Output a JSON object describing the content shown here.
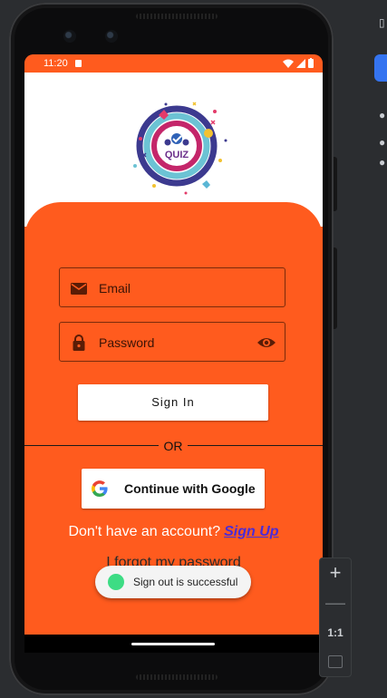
{
  "status_bar": {
    "time": "11:20"
  },
  "logo": {
    "text": "QUIZ",
    "icon": "quiz-logo"
  },
  "login": {
    "email_placeholder": "Email",
    "password_placeholder": "Password",
    "signin_label": "Sign In",
    "divider_text": "OR",
    "google_label": "Continue with Google",
    "signup_prompt": "Don't have an account?",
    "signup_link": "Sign Up",
    "forgot_label": "I forgot my password"
  },
  "toast": {
    "message": "Sign out is successful"
  },
  "emulator_zoom": {
    "plus": "+",
    "minus": "—",
    "ratio": "1:1"
  },
  "colors": {
    "primary_orange": "#ff5b1e",
    "link_purple": "#4b2cd6",
    "field_border": "#7a2b0c",
    "ide_accent": "#3574f0"
  }
}
